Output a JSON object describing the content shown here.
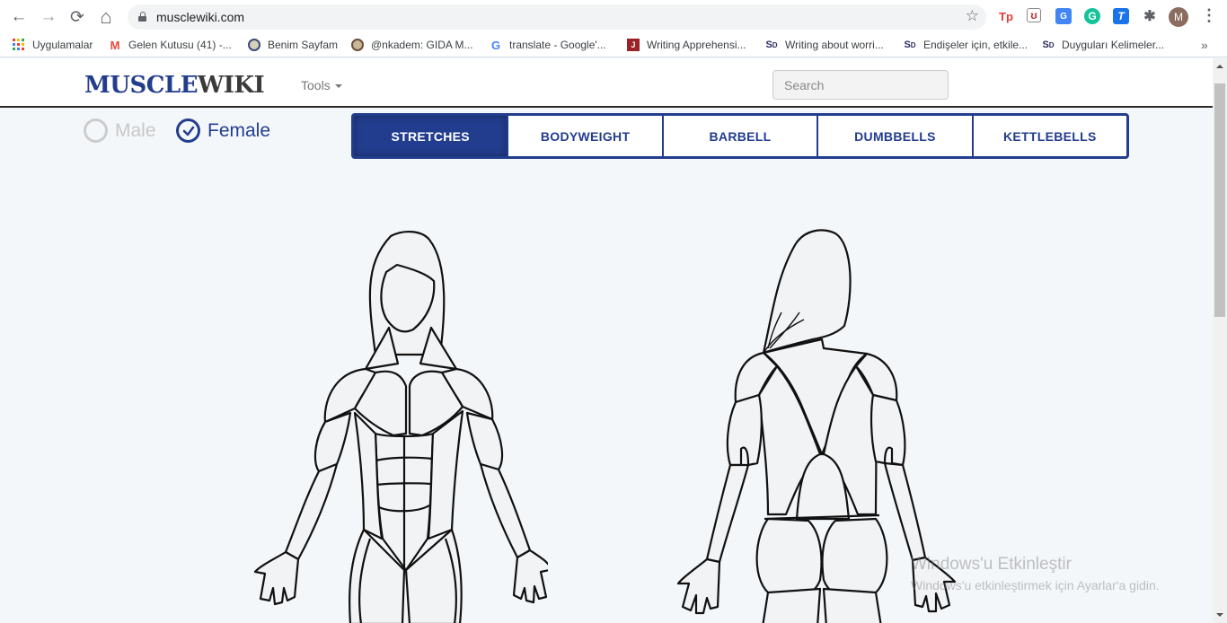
{
  "browser": {
    "url": "musclewiki.com",
    "nav": {
      "back": "←",
      "forward": "→",
      "reload": "⟳",
      "home": "⌂"
    },
    "star_icon": "☆",
    "extensions": [
      {
        "name": "tp-extension",
        "label": "Tp",
        "color": "#e53935"
      },
      {
        "name": "mcafee-extension",
        "label": "ʊ",
        "color": "#c62828"
      },
      {
        "name": "google-translate-extension",
        "label": "G",
        "color": "#4285f4"
      },
      {
        "name": "grammarly-extension",
        "label": "G",
        "color": "#15c39a"
      },
      {
        "name": "t-extension",
        "label": "T",
        "color": "#1a73e8"
      },
      {
        "name": "puzzle-extension",
        "label": "✱",
        "color": "#5f6368"
      }
    ],
    "profile_initial": "M",
    "menu_icon": "⋮",
    "bookmarks": [
      {
        "label": "Uygulamalar",
        "icon": "apps-grid"
      },
      {
        "label": "Gelen Kutusu (41) -...",
        "icon": "gmail"
      },
      {
        "label": "Benim Sayfam",
        "icon": "seal"
      },
      {
        "label": "@nkadem: GIDA M...",
        "icon": "seal"
      },
      {
        "label": "translate - Google'...",
        "icon": "google"
      },
      {
        "label": "Writing Apprehensi...",
        "icon": "jstor"
      },
      {
        "label": "Writing about worri...",
        "icon": "sd"
      },
      {
        "label": "Endişeler için, etkile...",
        "icon": "sd"
      },
      {
        "label": "Duyguları Kelimeler...",
        "icon": "sd"
      }
    ],
    "bookmarks_more": "»"
  },
  "site": {
    "logo_part1": "MUSCLE",
    "logo_part2": "WIKI",
    "tools_label": "Tools",
    "search_placeholder": "Search",
    "gender": {
      "male": "Male",
      "female": "Female",
      "selected": "Female"
    },
    "tabs": [
      {
        "label": "STRETCHES",
        "active": true
      },
      {
        "label": "BODYWEIGHT",
        "active": false
      },
      {
        "label": "BARBELL",
        "active": false
      },
      {
        "label": "DUMBBELLS",
        "active": false
      },
      {
        "label": "KETTLEBELLS",
        "active": false
      }
    ],
    "figures": {
      "front": "female-front-body-diagram",
      "back": "female-back-body-diagram"
    }
  },
  "watermark": {
    "title": "Windows'u Etkinleştir",
    "subtitle": "Windows'u etkinleştirmek için Ayarlar'a gidin."
  }
}
